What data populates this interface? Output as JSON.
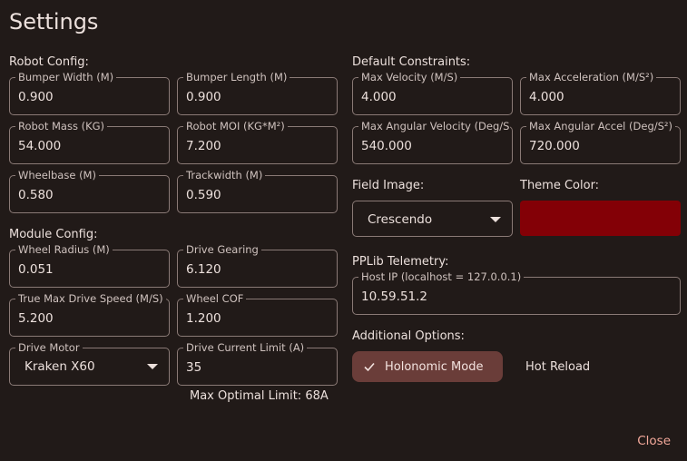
{
  "title": "Settings",
  "robot_config": {
    "heading": "Robot Config:",
    "bumper_width": {
      "label": "Bumper Width (M)",
      "value": "0.900"
    },
    "bumper_length": {
      "label": "Bumper Length (M)",
      "value": "0.900"
    },
    "robot_mass": {
      "label": "Robot Mass (KG)",
      "value": "54.000"
    },
    "robot_moi": {
      "label": "Robot MOI (KG*M²)",
      "value": "7.200"
    },
    "wheelbase": {
      "label": "Wheelbase (M)",
      "value": "0.580"
    },
    "trackwidth": {
      "label": "Trackwidth (M)",
      "value": "0.590"
    }
  },
  "module_config": {
    "heading": "Module Config:",
    "wheel_radius": {
      "label": "Wheel Radius (M)",
      "value": "0.051"
    },
    "drive_gearing": {
      "label": "Drive Gearing",
      "value": "6.120"
    },
    "max_drive_speed": {
      "label": "True Max Drive Speed (M/S)",
      "value": "5.200"
    },
    "wheel_cof": {
      "label": "Wheel COF",
      "value": "1.200"
    },
    "drive_motor": {
      "label": "Drive Motor",
      "value": "Kraken X60"
    },
    "current_limit": {
      "label": "Drive Current Limit (A)",
      "value": "35"
    },
    "max_optimal_limit": "Max Optimal Limit: 68A"
  },
  "default_constraints": {
    "heading": "Default Constraints:",
    "max_velocity": {
      "label": "Max Velocity (M/S)",
      "value": "4.000"
    },
    "max_acceleration": {
      "label": "Max Acceleration (M/S²)",
      "value": "4.000"
    },
    "max_angular_velocity": {
      "label": "Max Angular Velocity (Deg/S)",
      "value": "540.000"
    },
    "max_angular_accel": {
      "label": "Max Angular Accel (Deg/S²)",
      "value": "720.000"
    }
  },
  "field_image": {
    "heading": "Field Image:",
    "value": "Crescendo"
  },
  "theme_color": {
    "heading": "Theme Color:",
    "color": "#830006"
  },
  "pplib_telemetry": {
    "heading": "PPLib Telemetry:",
    "host_ip": {
      "label": "Host IP (localhost = 127.0.0.1)",
      "value": "10.59.51.2"
    }
  },
  "additional_options": {
    "heading": "Additional Options:",
    "holonomic_mode": {
      "label": "Holonomic Mode",
      "selected": true
    },
    "hot_reload": {
      "label": "Hot Reload",
      "selected": false
    }
  },
  "close_label": "Close",
  "icons": {
    "check": "check-icon",
    "dropdown": "chevron-down-icon"
  }
}
